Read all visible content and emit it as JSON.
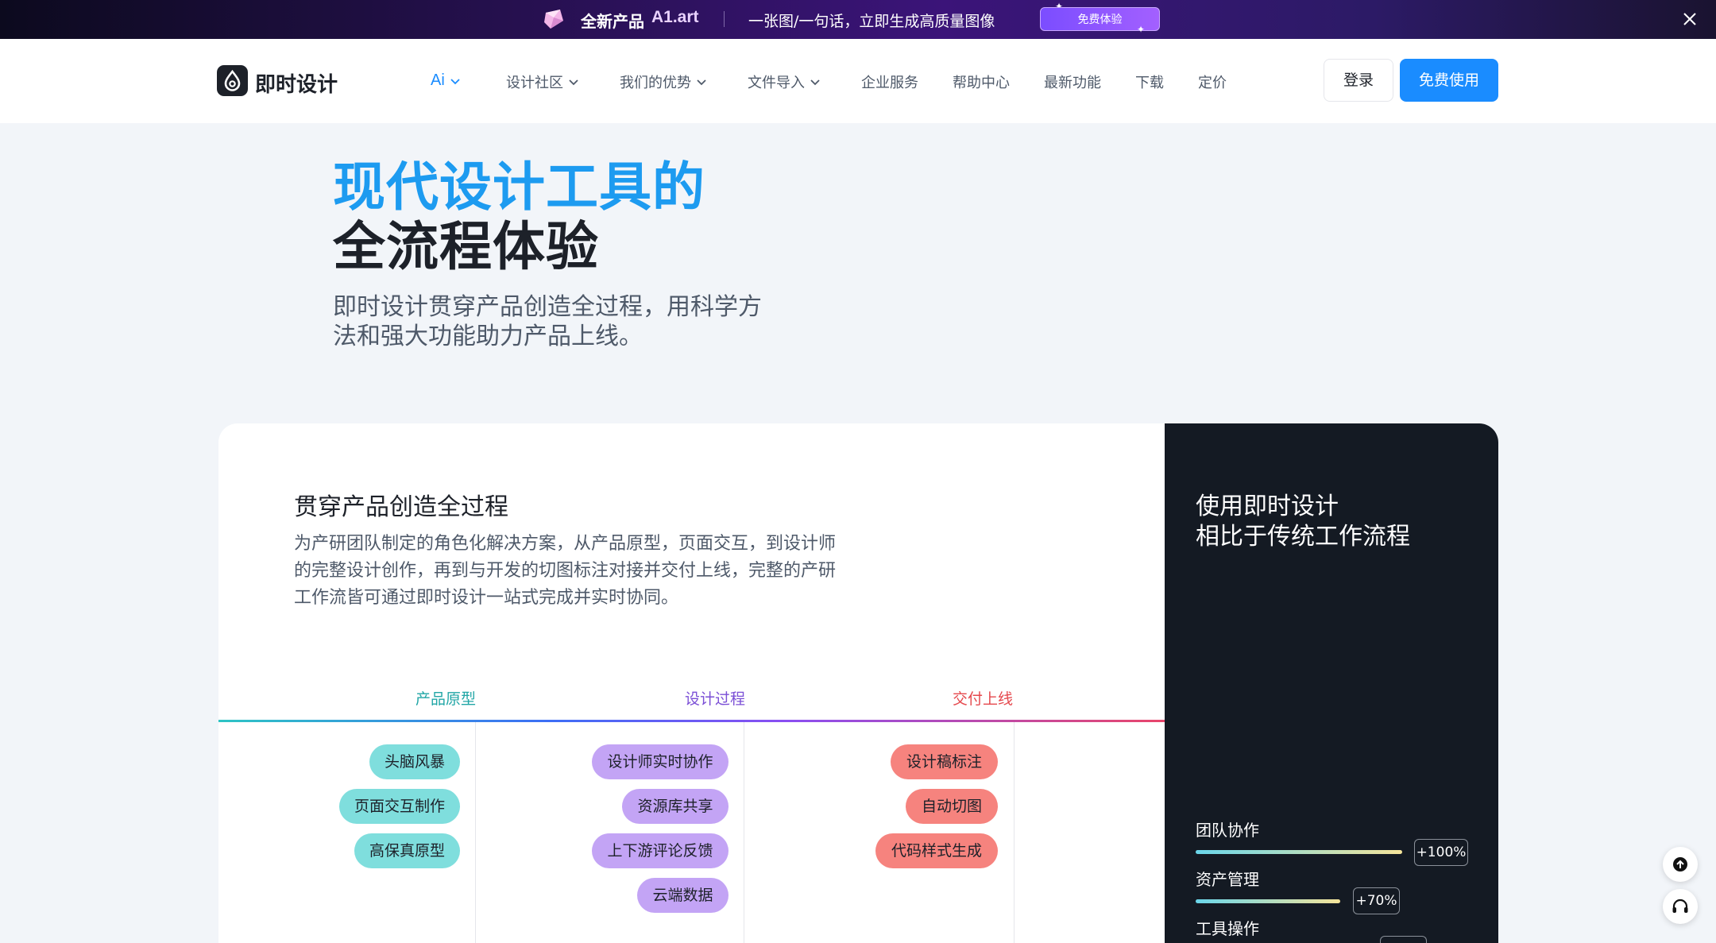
{
  "banner": {
    "product_label": "全新产品",
    "brand": "A1.art",
    "slogan": "一张图/一句话，立即生成高质量图像",
    "cta": "免费体验"
  },
  "header": {
    "logo_text": "即时设计",
    "nav": [
      {
        "label": "Ai",
        "dropdown": true,
        "active": true
      },
      {
        "label": "设计社区",
        "dropdown": true
      },
      {
        "label": "我们的优势",
        "dropdown": true
      },
      {
        "label": "文件导入",
        "dropdown": true
      },
      {
        "label": "企业服务",
        "dropdown": false
      },
      {
        "label": "帮助中心",
        "dropdown": false
      },
      {
        "label": "最新功能",
        "dropdown": false
      },
      {
        "label": "下载",
        "dropdown": false
      },
      {
        "label": "定价",
        "dropdown": false
      }
    ],
    "login": "登录",
    "free_use": "免费使用"
  },
  "hero": {
    "title_line1": "现代设计工具的",
    "title_line2": "全流程体验",
    "desc_line1": "即时设计贯穿产品创造全过程，用科学方",
    "desc_line2": "法和强大功能助力产品上线。"
  },
  "process": {
    "title": "贯穿产品创造全过程",
    "desc_lines": [
      "为产研团队制定的角色化解决方案，从产品原型，页面交互，到设计师",
      "的完整设计创作，再到与开发的切图标注对接并交付上线，完整的产研",
      "工作流皆可通过即时设计一站式完成并实时协同。"
    ],
    "columns": [
      {
        "label": "产品原型",
        "color": "#21a6a6",
        "items": [
          "头脑风暴",
          "页面交互制作",
          "高保真原型"
        ]
      },
      {
        "label": "设计过程",
        "color": "#7b4fd6",
        "items": [
          "设计师实时协作",
          "资源库共享",
          "上下游评论反馈",
          "云端数据"
        ]
      },
      {
        "label": "交付上线",
        "color": "#e5484d",
        "items": [
          "设计稿标注",
          "自动切图",
          "代码样式生成"
        ]
      }
    ]
  },
  "compare": {
    "title_line1": "使用即时设计",
    "title_line2": "相比于传统工作流程",
    "metrics": [
      {
        "label": "团队协作",
        "badge": "+100%",
        "value_percent": 100
      },
      {
        "label": "资产管理",
        "badge": "+70%",
        "value_percent": 70
      },
      {
        "label": "工具操作",
        "badge": "",
        "value_percent": null
      }
    ]
  },
  "colors": {
    "accent": "#1a8cff",
    "hero_blue": "#1d9bf0",
    "dark_panel": "#141a23"
  }
}
